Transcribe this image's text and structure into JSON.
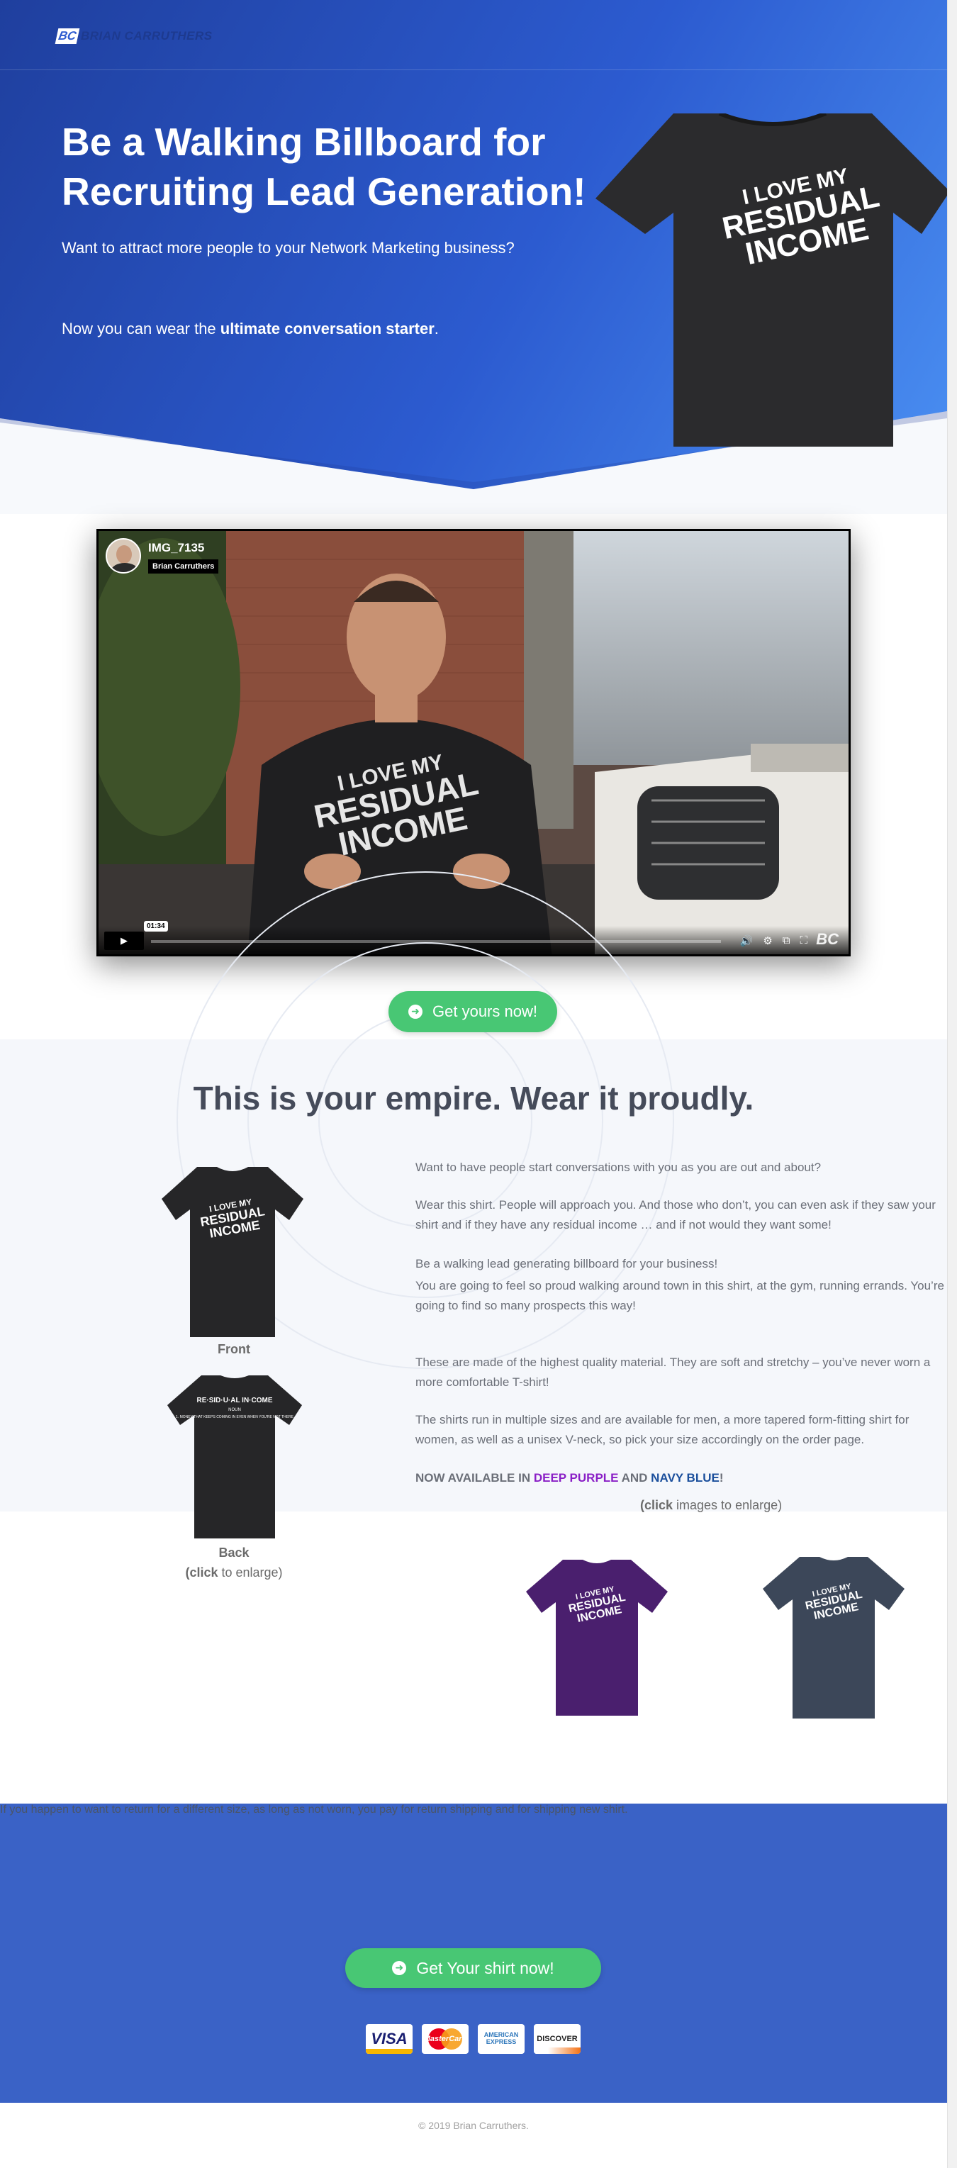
{
  "brand": {
    "mark": "BC",
    "name": "BRIAN CARRUTHERS"
  },
  "hero": {
    "title": "Be a Walking Billboard for Recruiting Lead Generation!",
    "subtitle": "Want to attract more people to your Network Marketing business?",
    "line2_prefix": "Now you can wear the ",
    "line2_bold": "ultimate conversation starter",
    "line2_suffix": "."
  },
  "shirt_print": {
    "l1": "I LOVE MY",
    "l2": "RESIDUAL",
    "l3": "INCOME"
  },
  "back_print": {
    "l1": "RE·SID·U·AL IN·COME",
    "l2": "NOUN",
    "l3": "1. MONEY THAT KEEPS COMING IN EVEN WHEN YOU'RE NOT THERE"
  },
  "video": {
    "title": "IMG_7135",
    "author": "Brian Carruthers",
    "time": "01:34",
    "logo": "BC"
  },
  "cta1": {
    "label": "Get yours now!"
  },
  "empire": {
    "heading": "This is your empire. Wear it proudly.",
    "p1": "Want to have people start conversations with you as you are out and about?",
    "p2": "Wear this shirt. People will approach you. And those who don’t, you can even ask if they saw your shirt and if they have any residual income … and if not would they want some!",
    "p3": "Be a walking lead generating billboard for your business!",
    "p4": "You are going to feel so proud walking around town in this shirt, at the gym, running errands.  You’re going to find so many prospects this way!",
    "p5": "These are made of the highest quality material.  They are soft and stretchy – you’ve never worn a more comfortable T-shirt!",
    "p6": "The shirts run in multiple sizes and are available for men, a more tapered form-fitting shirt for women, as well as a unisex V-neck,  so pick your size accordingly on the order page.",
    "avail_prefix": "NOW AVAILABLE IN ",
    "avail_purple": "DEEP PURPLE",
    "avail_mid": " AND ",
    "avail_navy": "NAVY BLUE",
    "avail_suffix": "!",
    "front_label": "Front",
    "back_label": "Back",
    "click_bold": "(click",
    "click_rest": " to enlarge)",
    "images_bold": "(click",
    "images_rest": " images to enlarge)"
  },
  "colors": {
    "purple": "#8a1fc6",
    "navy": "#1b4f9c",
    "cta": "#48c774",
    "band": "#3a62c6"
  },
  "band": {
    "note": "If you happen to want to return for a different size, as long as not worn, you pay for return shipping and for shipping new shirt."
  },
  "cta2": {
    "label": "Get Your shirt now!"
  },
  "payments": {
    "visa": "VISA",
    "mastercard": "MasterCard",
    "amex": "AMERICAN EXPRESS",
    "discover": "DISCOVER"
  },
  "footer": {
    "copyright": "© 2019 Brian Carruthers."
  }
}
